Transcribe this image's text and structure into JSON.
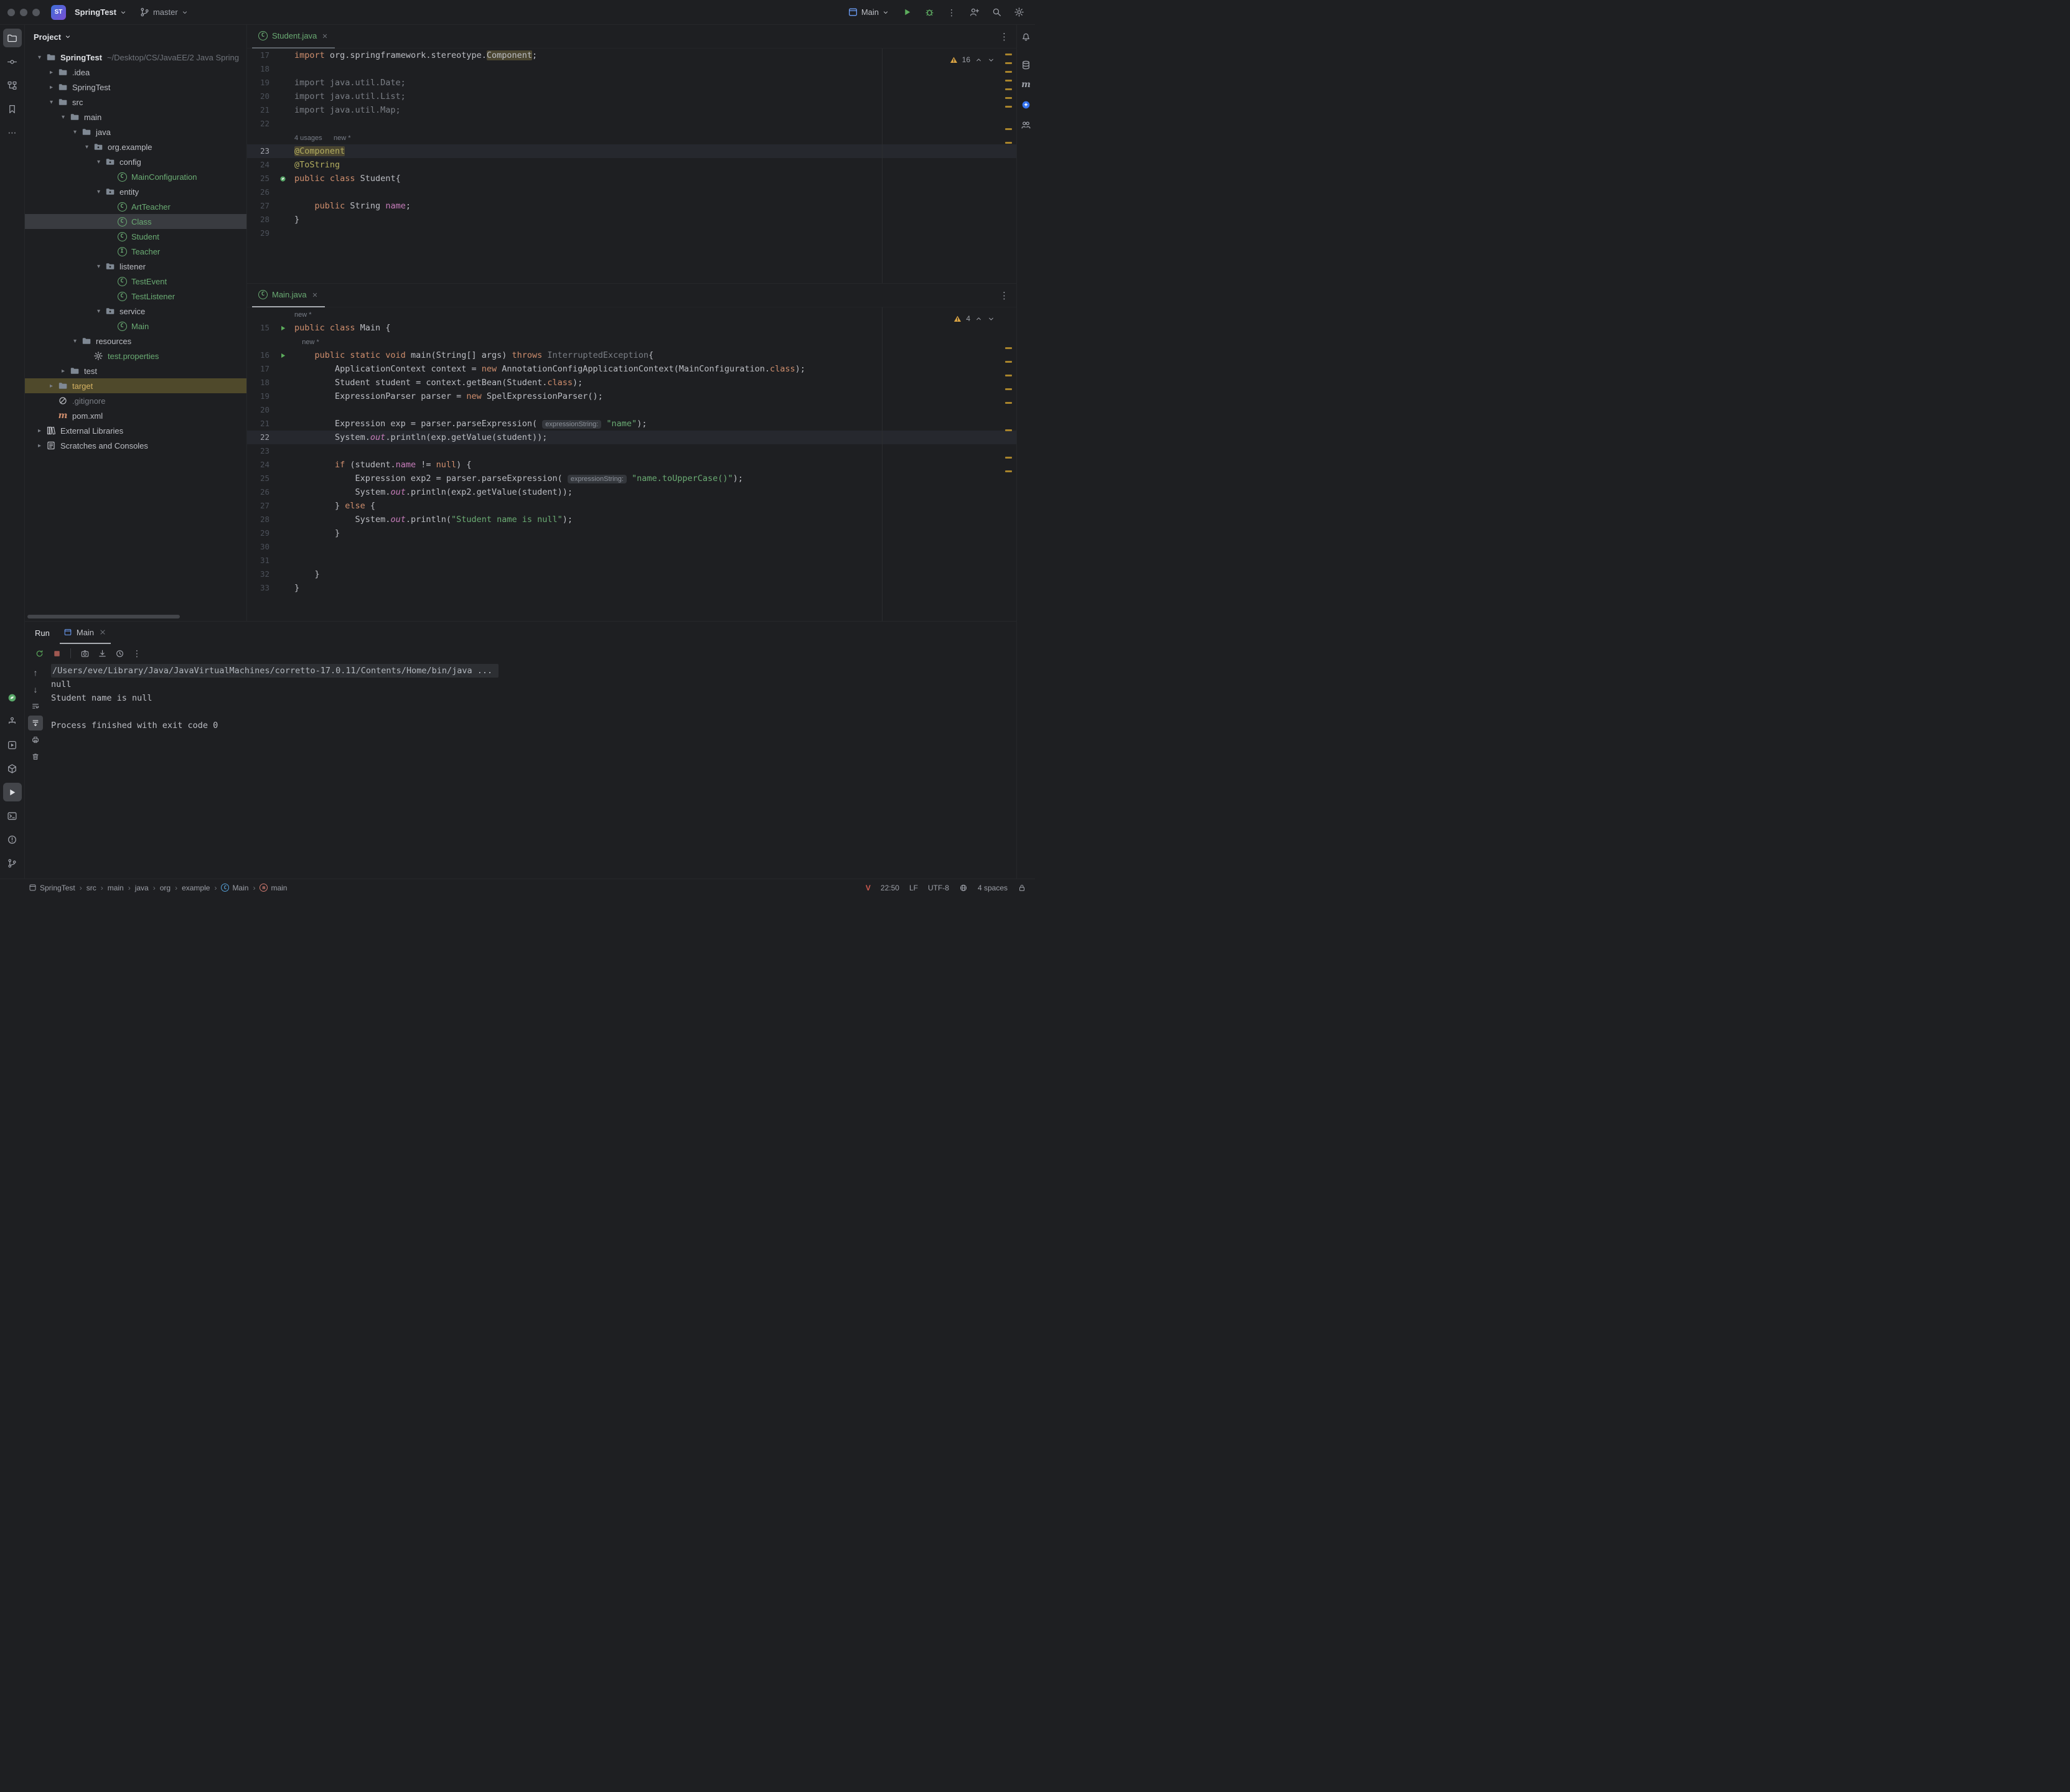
{
  "colors": {
    "background": "#1e1f22",
    "keyword": "#cf8e6d",
    "string": "#6aab73",
    "annotation": "#b3ae60",
    "vcs_added": "#6aab73",
    "warning": "#d9a343",
    "selection": "#393b40"
  },
  "titlebar": {
    "project_badge": "ST",
    "project_name": "SpringTest",
    "branch": "master",
    "run_config": "Main"
  },
  "left_strip": {
    "top": [
      {
        "name": "project",
        "active": true
      },
      {
        "name": "commit"
      },
      {
        "name": "structure"
      },
      {
        "name": "bookmarks"
      },
      {
        "name": "more-horizontal"
      }
    ],
    "bottom": [
      {
        "name": "spring"
      },
      {
        "name": "endpoints"
      },
      {
        "name": "services"
      },
      {
        "name": "build"
      },
      {
        "name": "run",
        "active": true
      },
      {
        "name": "terminal"
      },
      {
        "name": "problems"
      },
      {
        "name": "version-control"
      }
    ]
  },
  "right_strip": {
    "top": [
      {
        "name": "notifications"
      }
    ],
    "mid": [
      {
        "name": "database"
      },
      {
        "name": "maven"
      },
      {
        "name": "ai-assistant"
      },
      {
        "name": "code-with-me"
      }
    ]
  },
  "project_panel": {
    "title": "Project",
    "tree": [
      {
        "depth": 0,
        "chev": "open",
        "icon": "folder",
        "label": "SpringTest",
        "bold": true,
        "hint": "~/Desktop/CS/JavaEE/2 Java Spring"
      },
      {
        "depth": 1,
        "chev": "closed",
        "icon": "folder",
        "label": ".idea"
      },
      {
        "depth": 1,
        "chev": "closed",
        "icon": "folder",
        "label": "SpringTest"
      },
      {
        "depth": 1,
        "chev": "open",
        "icon": "folder",
        "label": "src"
      },
      {
        "depth": 2,
        "chev": "open",
        "icon": "folder",
        "label": "main"
      },
      {
        "depth": 3,
        "chev": "open",
        "icon": "folder",
        "label": "java"
      },
      {
        "depth": 4,
        "chev": "open",
        "icon": "package",
        "label": "org.example"
      },
      {
        "depth": 5,
        "chev": "open",
        "icon": "package",
        "label": "config"
      },
      {
        "depth": 6,
        "icon": "class",
        "label": "MainConfiguration",
        "state": "added"
      },
      {
        "depth": 5,
        "chev": "open",
        "icon": "package",
        "label": "entity"
      },
      {
        "depth": 6,
        "icon": "class",
        "label": "ArtTeacher",
        "state": "added"
      },
      {
        "depth": 6,
        "icon": "class",
        "label": "Class",
        "state": "added",
        "selected": true
      },
      {
        "depth": 6,
        "icon": "class",
        "label": "Student",
        "state": "added"
      },
      {
        "depth": 6,
        "icon": "interface",
        "label": "Teacher",
        "state": "added"
      },
      {
        "depth": 5,
        "chev": "open",
        "icon": "package",
        "label": "listener"
      },
      {
        "depth": 6,
        "icon": "class",
        "label": "TestEvent",
        "state": "added"
      },
      {
        "depth": 6,
        "icon": "class",
        "label": "TestListener",
        "state": "added"
      },
      {
        "depth": 5,
        "chev": "open",
        "icon": "package",
        "label": "service"
      },
      {
        "depth": 6,
        "icon": "class",
        "label": "Main",
        "state": "added"
      },
      {
        "depth": 3,
        "chev": "open",
        "icon": "folder",
        "label": "resources"
      },
      {
        "depth": 4,
        "icon": "gear-file",
        "label": "test.properties",
        "state": "added"
      },
      {
        "depth": 2,
        "chev": "closed",
        "icon": "folder",
        "label": "test"
      },
      {
        "depth": 1,
        "chev": "closed",
        "icon": "folder",
        "label": "target",
        "state": "excluded"
      },
      {
        "depth": 1,
        "icon": "ignored",
        "label": ".gitignore",
        "state": "ignored"
      },
      {
        "depth": 1,
        "icon": "maven",
        "label": "pom.xml"
      },
      {
        "depth": 0,
        "chev": "closed",
        "icon": "library",
        "label": "External Libraries"
      },
      {
        "depth": 0,
        "chev": "closed",
        "icon": "scratches",
        "label": "Scratches and Consoles"
      }
    ]
  },
  "editors": [
    {
      "tab": "Student.java",
      "warnings": "16",
      "stripe_marks": [
        8,
        22,
        36,
        50,
        64,
        78,
        92,
        128,
        150
      ],
      "lines": [
        {
          "n": "17",
          "seg": [
            [
              "import ",
              "kw"
            ],
            [
              "org.springframework.stereotype.",
              "d"
            ],
            [
              "Component",
              "hl"
            ],
            [
              ";",
              "d"
            ]
          ]
        },
        {
          "n": "18"
        },
        {
          "n": "19",
          "seg": [
            [
              "import java.util.Date;",
              "gr"
            ]
          ]
        },
        {
          "n": "20",
          "seg": [
            [
              "import java.util.List;",
              "gr"
            ]
          ]
        },
        {
          "n": "21",
          "seg": [
            [
              "import java.util.Map;",
              "gr"
            ]
          ]
        },
        {
          "n": "22"
        },
        {
          "hint": "4 usages      new *"
        },
        {
          "n": "23",
          "caret": true,
          "seg": [
            [
              "@Component",
              "annhl"
            ]
          ]
        },
        {
          "n": "24",
          "seg": [
            [
              "@ToString",
              "ann"
            ]
          ]
        },
        {
          "n": "25",
          "gicon": "bean",
          "seg": [
            [
              "public class ",
              "kw"
            ],
            [
              "Student",
              "d"
            ],
            [
              "{",
              "d"
            ]
          ]
        },
        {
          "n": "26"
        },
        {
          "n": "27",
          "seg": [
            [
              "    ",
              "d"
            ],
            [
              "public ",
              "kw"
            ],
            [
              "String ",
              "d"
            ],
            [
              "name",
              "fld"
            ],
            [
              ";",
              "d"
            ]
          ]
        },
        {
          "n": "28",
          "seg": [
            [
              "}",
              "d"
            ]
          ]
        },
        {
          "n": "29"
        }
      ]
    },
    {
      "tab": "Main.java",
      "warnings": "4",
      "stripe_marks": [
        64,
        86,
        108,
        130,
        152,
        196,
        240,
        262
      ],
      "lines": [
        {
          "hint": "new *"
        },
        {
          "n": "15",
          "gicon": "run",
          "seg": [
            [
              "public class ",
              "kw"
            ],
            [
              "Main",
              "d"
            ],
            [
              " {",
              "d"
            ]
          ]
        },
        {
          "hint": "    new *"
        },
        {
          "n": "16",
          "gicon": "run",
          "seg": [
            [
              "    ",
              "d"
            ],
            [
              "public static void ",
              "kw"
            ],
            [
              "main",
              "d"
            ],
            [
              "(String[] args) ",
              "d"
            ],
            [
              "throws ",
              "kw"
            ],
            [
              "InterruptedException",
              "gr"
            ],
            [
              "{",
              "d"
            ]
          ]
        },
        {
          "n": "17",
          "seg": [
            [
              "        ApplicationContext context = ",
              "d"
            ],
            [
              "new ",
              "kw"
            ],
            [
              "AnnotationConfigApplicationContext(MainConfiguration.",
              "d"
            ],
            [
              "class",
              "kw"
            ],
            [
              ");",
              "d"
            ]
          ]
        },
        {
          "n": "18",
          "seg": [
            [
              "        Student student = context.getBean(Student.",
              "d"
            ],
            [
              "class",
              "kw"
            ],
            [
              ");",
              "d"
            ]
          ]
        },
        {
          "n": "19",
          "seg": [
            [
              "        ExpressionParser parser = ",
              "d"
            ],
            [
              "new ",
              "kw"
            ],
            [
              "SpelExpressionParser();",
              "d"
            ]
          ]
        },
        {
          "n": "20"
        },
        {
          "n": "21",
          "seg": [
            [
              "        Expression exp = parser.parseExpression( ",
              "d"
            ],
            [
              "expressionString:",
              "inlay"
            ],
            [
              " ",
              "d"
            ],
            [
              "\"name\"",
              "str"
            ],
            [
              ");",
              "d"
            ]
          ]
        },
        {
          "n": "22",
          "caret": true,
          "seg": [
            [
              "        System.",
              "d"
            ],
            [
              "out",
              "fldi"
            ],
            [
              ".println(exp.getValue(student));",
              "d"
            ]
          ]
        },
        {
          "n": "23"
        },
        {
          "n": "24",
          "seg": [
            [
              "        ",
              "d"
            ],
            [
              "if ",
              "kw"
            ],
            [
              "(student.",
              "d"
            ],
            [
              "name",
              "fld"
            ],
            [
              " != ",
              "d"
            ],
            [
              "null",
              "kw"
            ],
            [
              ") {",
              "d"
            ]
          ]
        },
        {
          "n": "25",
          "seg": [
            [
              "            Expression exp2 = parser.parseExpression( ",
              "d"
            ],
            [
              "expressionString:",
              "inlay"
            ],
            [
              " ",
              "d"
            ],
            [
              "\"name.toUpperCase()\"",
              "str"
            ],
            [
              ");",
              "d"
            ]
          ]
        },
        {
          "n": "26",
          "seg": [
            [
              "            System.",
              "d"
            ],
            [
              "out",
              "fldi"
            ],
            [
              ".println(exp2.getValue(student));",
              "d"
            ]
          ]
        },
        {
          "n": "27",
          "seg": [
            [
              "        } ",
              "d"
            ],
            [
              "else ",
              "kw"
            ],
            [
              "{",
              "d"
            ]
          ]
        },
        {
          "n": "28",
          "seg": [
            [
              "            System.",
              "d"
            ],
            [
              "out",
              "fldi"
            ],
            [
              ".println(",
              "d"
            ],
            [
              "\"Student name is null\"",
              "str"
            ],
            [
              ");",
              "d"
            ]
          ]
        },
        {
          "n": "29",
          "seg": [
            [
              "        }",
              "d"
            ]
          ]
        },
        {
          "n": "30"
        },
        {
          "n": "31"
        },
        {
          "n": "32",
          "seg": [
            [
              "    }",
              "d"
            ]
          ]
        },
        {
          "n": "33",
          "seg": [
            [
              "}",
              "d"
            ]
          ]
        }
      ]
    }
  ],
  "run_panel": {
    "title": "Run",
    "tab": "Main",
    "toolbar": [
      {
        "name": "rerun"
      },
      {
        "name": "stop"
      },
      {
        "name": "separator"
      },
      {
        "name": "camera"
      },
      {
        "name": "import"
      },
      {
        "name": "history"
      },
      {
        "name": "more-vertical"
      }
    ],
    "gutter": [
      {
        "name": "up"
      },
      {
        "name": "down"
      },
      {
        "name": "soft-wrap"
      },
      {
        "name": "scroll-to-end",
        "active": true
      },
      {
        "name": "print"
      },
      {
        "name": "clear"
      }
    ],
    "console": [
      {
        "text": "/Users/eve/Library/Java/JavaVirtualMachines/corretto-17.0.11/Contents/Home/bin/java ...",
        "cls": "cmd"
      },
      {
        "text": "null"
      },
      {
        "text": "Student name is null"
      },
      {
        "text": ""
      },
      {
        "text": "Process finished with exit code 0"
      }
    ]
  },
  "statusbar": {
    "breadcrumbs": [
      {
        "label": "SpringTest",
        "icon": "window"
      },
      {
        "label": "src"
      },
      {
        "label": "main"
      },
      {
        "label": "java"
      },
      {
        "label": "org"
      },
      {
        "label": "example"
      },
      {
        "label": "Main",
        "icon": "class-c"
      },
      {
        "label": "main",
        "icon": "method-m"
      }
    ],
    "vim": "V",
    "caret": "22:50",
    "line_sep": "LF",
    "encoding": "UTF-8",
    "indent": "4 spaces"
  }
}
